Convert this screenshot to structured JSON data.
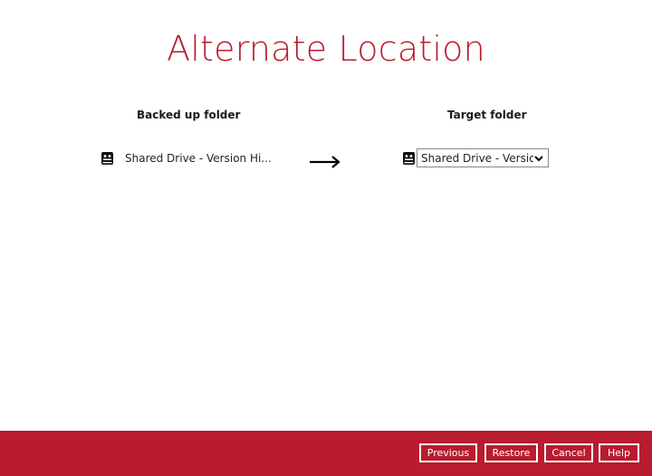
{
  "page": {
    "title": "Alternate Location"
  },
  "columns": {
    "source_header": "Backed up folder",
    "target_header": "Target folder"
  },
  "source": {
    "label": "Shared Drive - Version Hi...",
    "icon": "shared-drive-icon"
  },
  "target": {
    "selected": "Shared Drive - Version ...",
    "icon": "shared-drive-icon"
  },
  "arrow": "right-arrow-icon",
  "footer": {
    "previous": "Previous",
    "restore": "Restore",
    "cancel": "Cancel",
    "help": "Help"
  },
  "colors": {
    "title": "#b81c2e",
    "footer_bg": "#b81c2e",
    "button_border": "#ffffff"
  }
}
